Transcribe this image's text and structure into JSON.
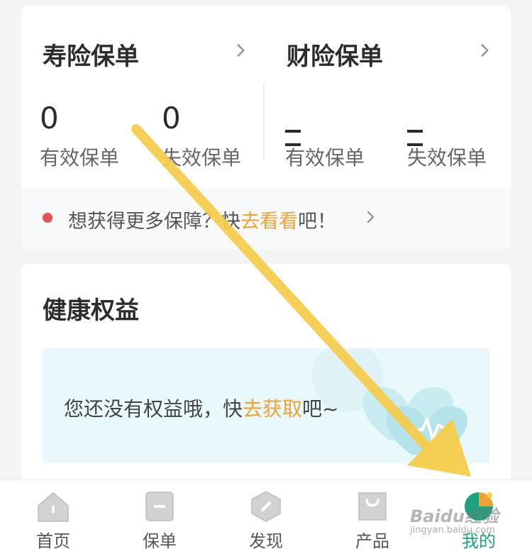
{
  "policies": {
    "life": {
      "title": "寿险保单",
      "valid_count": "0",
      "invalid_count": "0",
      "valid_label": "有效保单",
      "invalid_label": "失效保单"
    },
    "property": {
      "title": "财险保单",
      "valid_label": "有效保单",
      "invalid_label": "失效保单"
    },
    "tip": {
      "prefix": "想获得更多保障？快",
      "link": "去看看",
      "suffix": "吧！"
    }
  },
  "benefits": {
    "title": "健康权益",
    "empty_prefix": "您还没有权益哦，快",
    "empty_link": "去获取",
    "empty_suffix": "吧~"
  },
  "tabbar": {
    "items": [
      {
        "label": "首页",
        "icon": "home-icon"
      },
      {
        "label": "保单",
        "icon": "policy-icon"
      },
      {
        "label": "发现",
        "icon": "discover-icon"
      },
      {
        "label": "产品",
        "icon": "product-bag-icon"
      },
      {
        "label": "我的",
        "icon": "profile-icon",
        "active": true
      }
    ]
  },
  "watermark": {
    "brand": "Baidu经验",
    "url": "jingyan.baidu.com"
  },
  "colors": {
    "accent_orange": "#f0a232",
    "active_green": "#1ca27e",
    "tip_dot_red": "#e8504f",
    "annotation_arrow": "#f6cc4a"
  }
}
